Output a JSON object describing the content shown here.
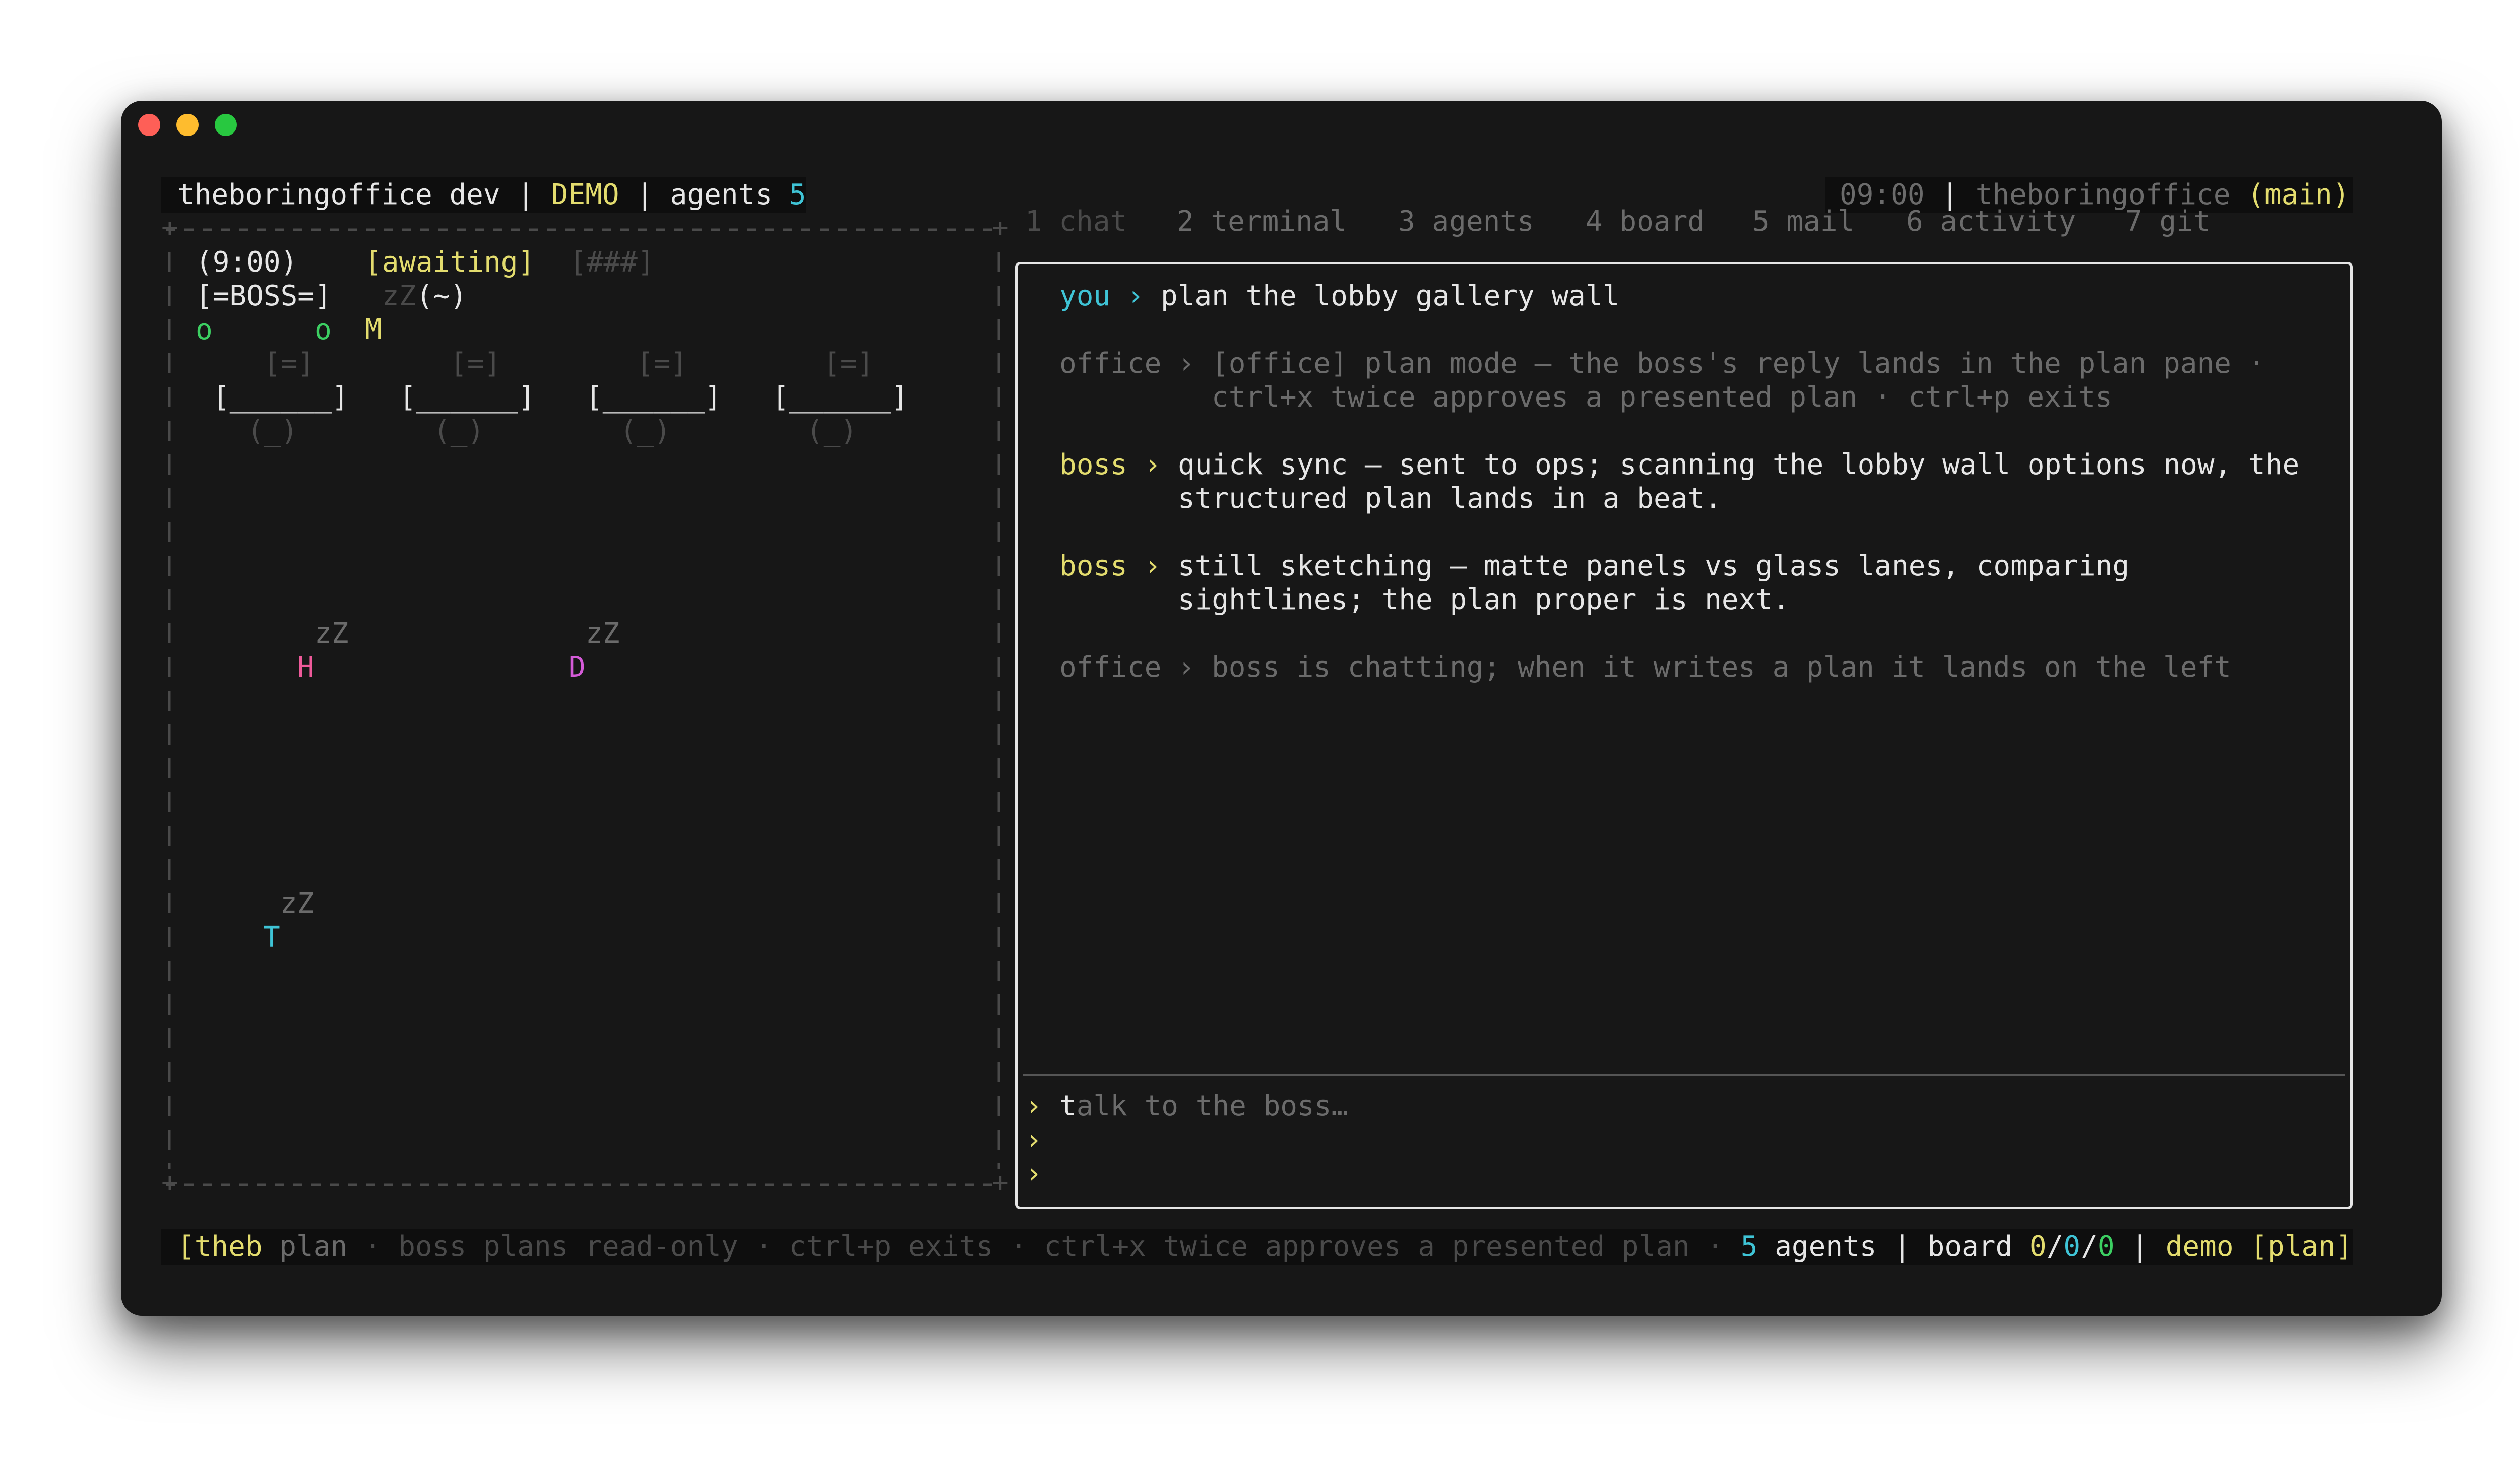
{
  "header_left": {
    "app": "theboringoffice dev",
    "sep1": " | ",
    "mode": "DEMO",
    "sep2": " | agents ",
    "agent_count": "5"
  },
  "header_right": {
    "time": "09:00",
    "sep": " | ",
    "repo": "theboringoffice",
    "branch": "(main)"
  },
  "tabs": [
    {
      "label": "1 chat"
    },
    {
      "label": "2 terminal"
    },
    {
      "label": "3 agents"
    },
    {
      "label": "4 board"
    },
    {
      "label": "5 mail"
    },
    {
      "label": "6 activity"
    },
    {
      "label": "7 git"
    }
  ],
  "office": {
    "time": "(9:00)",
    "status": "[awaiting]",
    "progress": "[###]",
    "boss": "[=BOSS=]",
    "boss_sleep": "zZ",
    "boss_face": "(~)",
    "agent_o1": "o",
    "agent_o2": "o",
    "agent_m": "M",
    "monitor": "[=]",
    "desk": "[______]",
    "chair": "(_)",
    "sleep": "zZ",
    "agent_h": "H",
    "agent_d": "D",
    "agent_t": "T"
  },
  "chat": {
    "messages": [
      {
        "speaker": "you",
        "arrow": "›",
        "lines": [
          "plan the lobby gallery wall"
        ]
      },
      {
        "speaker": "office",
        "arrow": "›",
        "lines": [
          "[office] plan mode — the boss's reply lands in the plan pane ·",
          "ctrl+x twice approves a presented plan · ctrl+p exits"
        ]
      },
      {
        "speaker": "boss",
        "arrow": "›",
        "lines": [
          "quick sync — sent to ops; scanning the lobby wall options now, the",
          "structured plan lands in a beat."
        ]
      },
      {
        "speaker": "boss",
        "arrow": "›",
        "lines": [
          "still sketching — matte panels vs glass lanes, comparing",
          "sightlines; the plan proper is next."
        ]
      },
      {
        "speaker": "office",
        "arrow": "›",
        "lines": [
          "boss is chatting; when it writes a plan it lands on the left"
        ]
      }
    ],
    "input_prompt": "›",
    "input_placeholder_cursor": "t",
    "input_placeholder_rest": "alk to the boss…"
  },
  "status_bar": {
    "left_badge": "[theb",
    "mode": "plan",
    "hint": " · boss plans read-only · ctrl+p exits · ctrl+x twice approves a presented plan · ",
    "agent_count": "5",
    "agents_label": " agents | board ",
    "board_a": "0",
    "board_slash1": "/",
    "board_b": "0",
    "board_slash2": "/",
    "board_c": "0",
    "sep": " | ",
    "demo": "demo [plan]"
  },
  "colors": {
    "background": "#171717",
    "text": "#e6e6e6",
    "dim": "#6b6b6b",
    "yellow": "#e3dc6e",
    "cyan": "#3fc4d6",
    "green": "#3ccf62",
    "pink": "#ef5a9a",
    "magenta": "#d55bd8"
  }
}
